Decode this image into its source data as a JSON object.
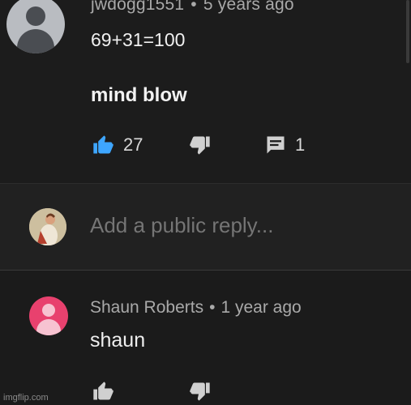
{
  "comment": {
    "author": "jwdogg1551",
    "separator": "•",
    "time": "5 years ago",
    "line1": "69+31=100",
    "line2": "mind blow",
    "like_count": "27",
    "reply_count": "1"
  },
  "reply_box": {
    "placeholder": "Add a public reply..."
  },
  "reply": {
    "author": "Shaun Roberts",
    "separator": "•",
    "time": "1 year ago",
    "text": "shaun"
  },
  "watermark": "imgflip.com",
  "colors": {
    "like_active": "#3ea6ff",
    "icon_inactive": "#d0d0d0",
    "avatar_shaun": "#e8416e"
  },
  "icons": [
    "thumbs-up-icon",
    "thumbs-down-icon",
    "reply-comment-icon"
  ]
}
